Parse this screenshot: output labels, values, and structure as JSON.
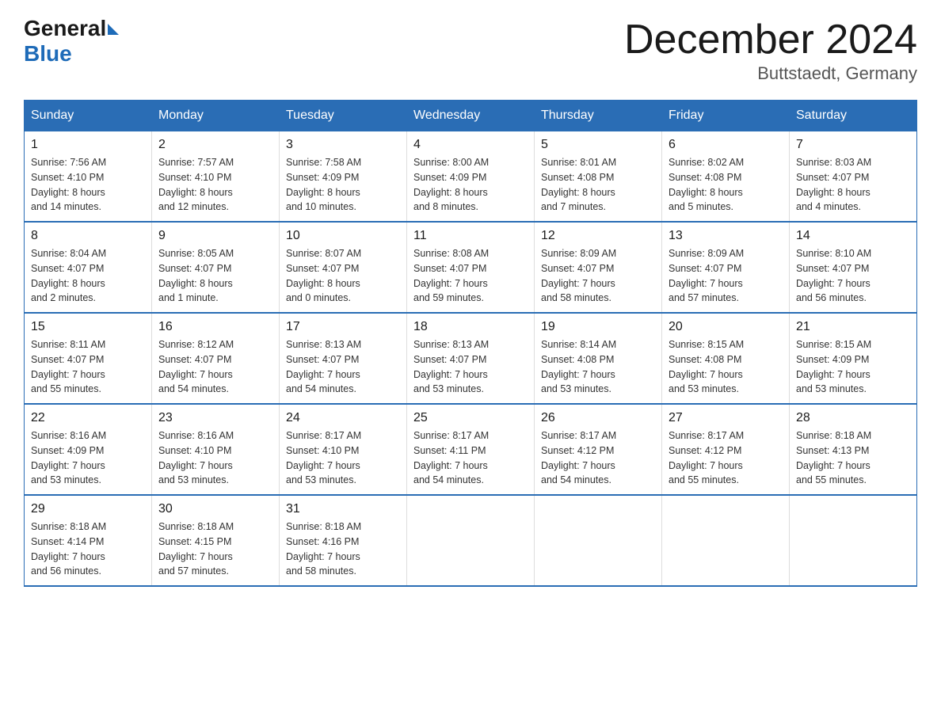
{
  "logo": {
    "general": "General",
    "blue": "Blue"
  },
  "header": {
    "title": "December 2024",
    "location": "Buttstaedt, Germany"
  },
  "weekdays": [
    "Sunday",
    "Monday",
    "Tuesday",
    "Wednesday",
    "Thursday",
    "Friday",
    "Saturday"
  ],
  "weeks": [
    [
      {
        "day": "1",
        "sunrise": "7:56 AM",
        "sunset": "4:10 PM",
        "daylight": "8 hours and 14 minutes."
      },
      {
        "day": "2",
        "sunrise": "7:57 AM",
        "sunset": "4:10 PM",
        "daylight": "8 hours and 12 minutes."
      },
      {
        "day": "3",
        "sunrise": "7:58 AM",
        "sunset": "4:09 PM",
        "daylight": "8 hours and 10 minutes."
      },
      {
        "day": "4",
        "sunrise": "8:00 AM",
        "sunset": "4:09 PM",
        "daylight": "8 hours and 8 minutes."
      },
      {
        "day": "5",
        "sunrise": "8:01 AM",
        "sunset": "4:08 PM",
        "daylight": "8 hours and 7 minutes."
      },
      {
        "day": "6",
        "sunrise": "8:02 AM",
        "sunset": "4:08 PM",
        "daylight": "8 hours and 5 minutes."
      },
      {
        "day": "7",
        "sunrise": "8:03 AM",
        "sunset": "4:07 PM",
        "daylight": "8 hours and 4 minutes."
      }
    ],
    [
      {
        "day": "8",
        "sunrise": "8:04 AM",
        "sunset": "4:07 PM",
        "daylight": "8 hours and 2 minutes."
      },
      {
        "day": "9",
        "sunrise": "8:05 AM",
        "sunset": "4:07 PM",
        "daylight": "8 hours and 1 minute."
      },
      {
        "day": "10",
        "sunrise": "8:07 AM",
        "sunset": "4:07 PM",
        "daylight": "8 hours and 0 minutes."
      },
      {
        "day": "11",
        "sunrise": "8:08 AM",
        "sunset": "4:07 PM",
        "daylight": "7 hours and 59 minutes."
      },
      {
        "day": "12",
        "sunrise": "8:09 AM",
        "sunset": "4:07 PM",
        "daylight": "7 hours and 58 minutes."
      },
      {
        "day": "13",
        "sunrise": "8:09 AM",
        "sunset": "4:07 PM",
        "daylight": "7 hours and 57 minutes."
      },
      {
        "day": "14",
        "sunrise": "8:10 AM",
        "sunset": "4:07 PM",
        "daylight": "7 hours and 56 minutes."
      }
    ],
    [
      {
        "day": "15",
        "sunrise": "8:11 AM",
        "sunset": "4:07 PM",
        "daylight": "7 hours and 55 minutes."
      },
      {
        "day": "16",
        "sunrise": "8:12 AM",
        "sunset": "4:07 PM",
        "daylight": "7 hours and 54 minutes."
      },
      {
        "day": "17",
        "sunrise": "8:13 AM",
        "sunset": "4:07 PM",
        "daylight": "7 hours and 54 minutes."
      },
      {
        "day": "18",
        "sunrise": "8:13 AM",
        "sunset": "4:07 PM",
        "daylight": "7 hours and 53 minutes."
      },
      {
        "day": "19",
        "sunrise": "8:14 AM",
        "sunset": "4:08 PM",
        "daylight": "7 hours and 53 minutes."
      },
      {
        "day": "20",
        "sunrise": "8:15 AM",
        "sunset": "4:08 PM",
        "daylight": "7 hours and 53 minutes."
      },
      {
        "day": "21",
        "sunrise": "8:15 AM",
        "sunset": "4:09 PM",
        "daylight": "7 hours and 53 minutes."
      }
    ],
    [
      {
        "day": "22",
        "sunrise": "8:16 AM",
        "sunset": "4:09 PM",
        "daylight": "7 hours and 53 minutes."
      },
      {
        "day": "23",
        "sunrise": "8:16 AM",
        "sunset": "4:10 PM",
        "daylight": "7 hours and 53 minutes."
      },
      {
        "day": "24",
        "sunrise": "8:17 AM",
        "sunset": "4:10 PM",
        "daylight": "7 hours and 53 minutes."
      },
      {
        "day": "25",
        "sunrise": "8:17 AM",
        "sunset": "4:11 PM",
        "daylight": "7 hours and 54 minutes."
      },
      {
        "day": "26",
        "sunrise": "8:17 AM",
        "sunset": "4:12 PM",
        "daylight": "7 hours and 54 minutes."
      },
      {
        "day": "27",
        "sunrise": "8:17 AM",
        "sunset": "4:12 PM",
        "daylight": "7 hours and 55 minutes."
      },
      {
        "day": "28",
        "sunrise": "8:18 AM",
        "sunset": "4:13 PM",
        "daylight": "7 hours and 55 minutes."
      }
    ],
    [
      {
        "day": "29",
        "sunrise": "8:18 AM",
        "sunset": "4:14 PM",
        "daylight": "7 hours and 56 minutes."
      },
      {
        "day": "30",
        "sunrise": "8:18 AM",
        "sunset": "4:15 PM",
        "daylight": "7 hours and 57 minutes."
      },
      {
        "day": "31",
        "sunrise": "8:18 AM",
        "sunset": "4:16 PM",
        "daylight": "7 hours and 58 minutes."
      },
      null,
      null,
      null,
      null
    ]
  ],
  "labels": {
    "sunrise": "Sunrise:",
    "sunset": "Sunset:",
    "daylight": "Daylight:"
  }
}
